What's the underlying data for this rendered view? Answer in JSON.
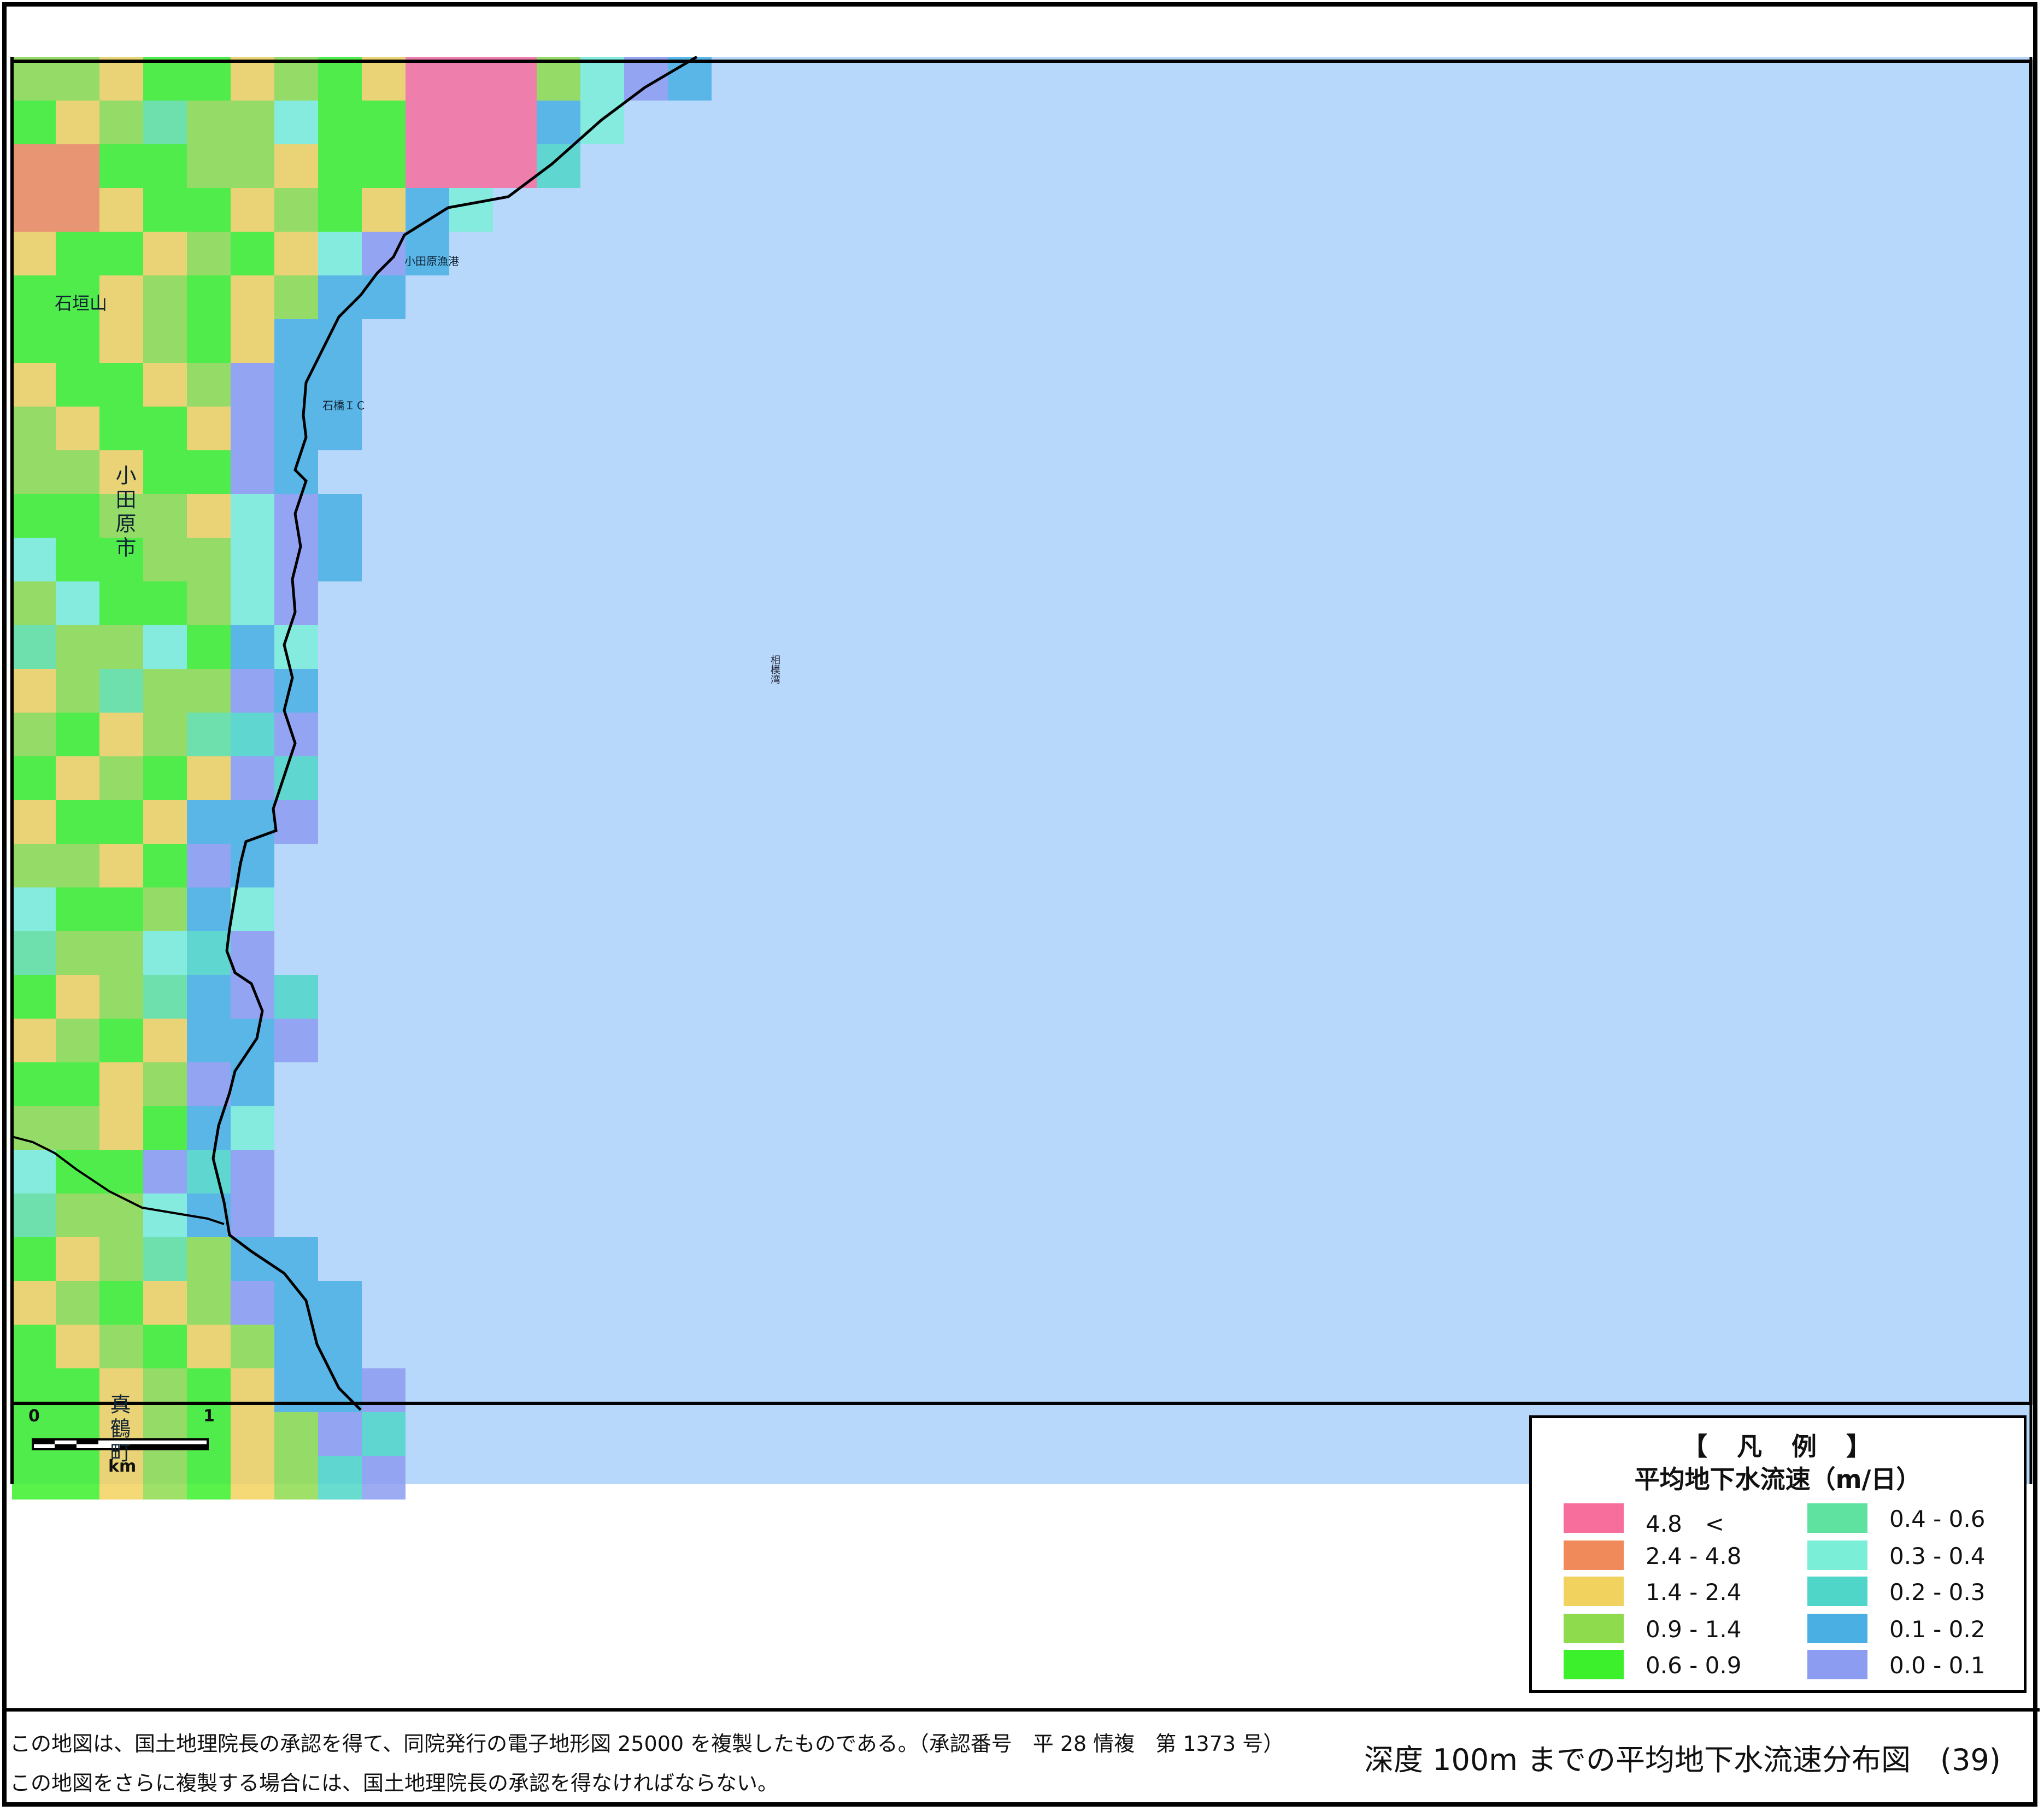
{
  "map": {
    "sea_label": "相模湾",
    "city_label": "小田原市",
    "town_label": "真鶴町",
    "place_labels": [
      {
        "id": "mountain",
        "text": "石垣山"
      },
      {
        "id": "port",
        "text": "小田原漁港"
      },
      {
        "id": "ic",
        "text": "石橋ＩＣ"
      }
    ],
    "scale_bar": {
      "start": "0",
      "end": "1",
      "unit": "km"
    },
    "colors": {
      "sea": "#b8d8fb",
      "frame": "#000000"
    }
  },
  "legend": {
    "title": "【　凡　例　】",
    "subtitle": "平均地下水流速（m/日）",
    "items": [
      {
        "label": "4.8　<",
        "color": "#f76e9c"
      },
      {
        "label": "2.4 - 4.8",
        "color": "#f08a5a"
      },
      {
        "label": "1.4 - 2.4",
        "color": "#f2d25e"
      },
      {
        "label": "0.9 - 1.4",
        "color": "#8edc4e"
      },
      {
        "label": "0.6 - 0.9",
        "color": "#3cf02c"
      },
      {
        "label": "0.4 - 0.6",
        "color": "#5fe2a0"
      },
      {
        "label": "0.3 - 0.4",
        "color": "#7beed8"
      },
      {
        "label": "0.2 - 0.3",
        "color": "#4fd6c8"
      },
      {
        "label": "0.1 - 0.2",
        "color": "#4ab0e4"
      },
      {
        "label": "0.0 - 0.1",
        "color": "#8c9cf0"
      }
    ]
  },
  "footer": {
    "copyright_line1": "この地図は、国土地理院長の承認を得て、同院発行の電子地形図 25000 を複製したものである。（承認番号　平 28 情複　第 1373 号）",
    "copyright_line2": "この地図をさらに複製する場合には、国土地理院長の承認を得なければならない。",
    "title": "深度 100m までの平均地下水流速分布図　(39)"
  }
}
